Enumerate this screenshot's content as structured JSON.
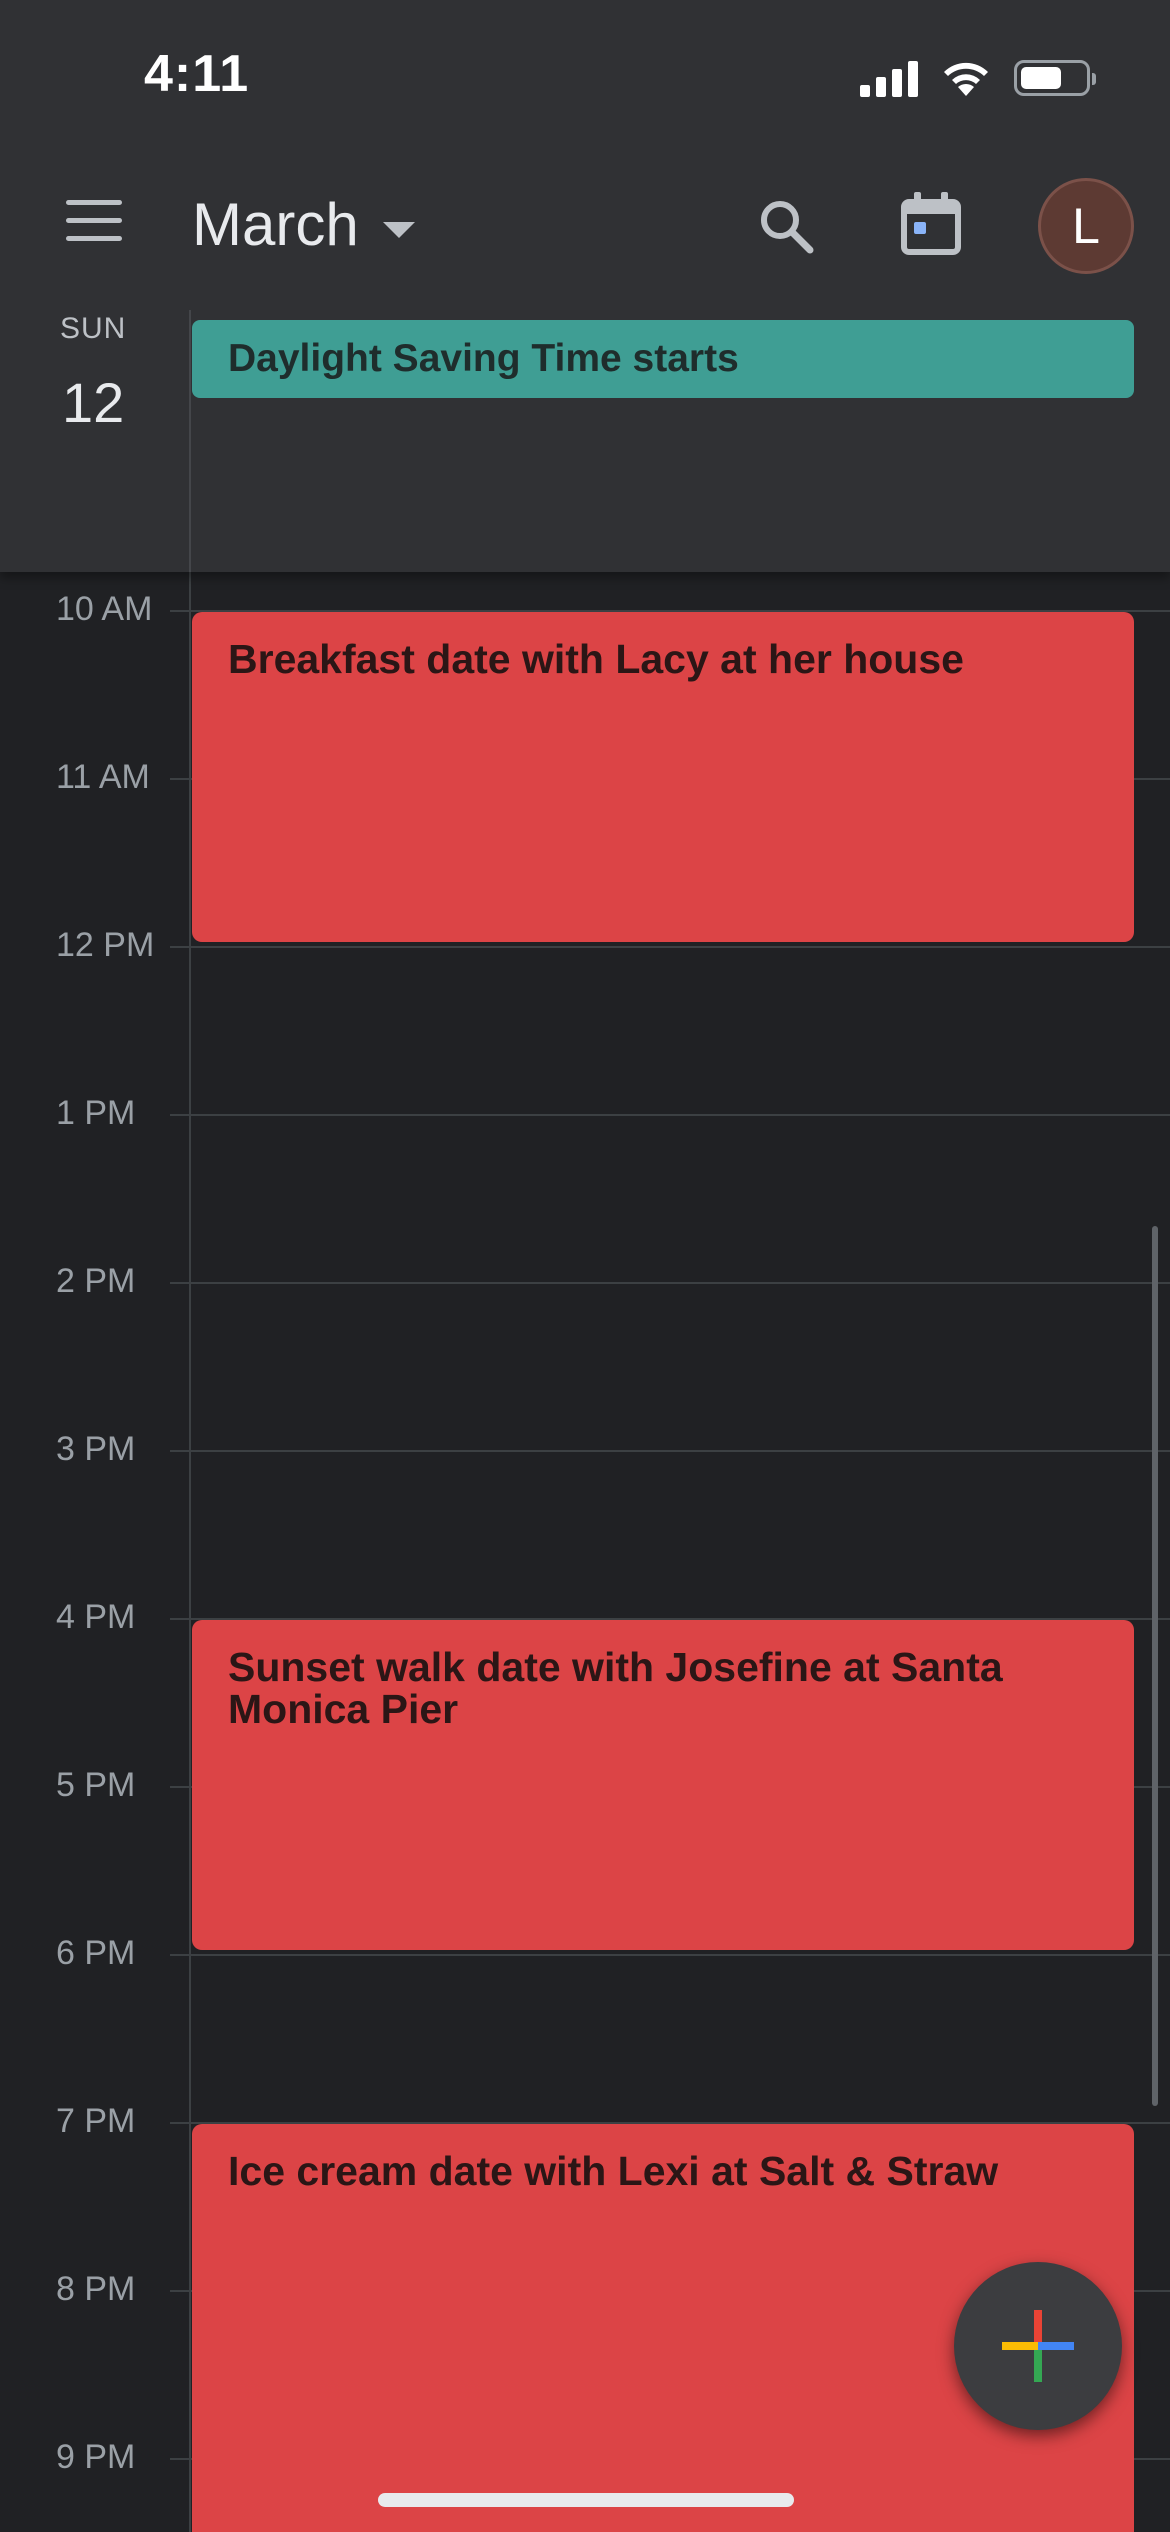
{
  "status_bar": {
    "time": "4:11"
  },
  "header": {
    "month": "March",
    "avatar_initial": "L",
    "day_of_week": "SUN",
    "day_number": "12",
    "all_day_event": "Daylight Saving Time starts"
  },
  "colors": {
    "background": "#202124",
    "header_background": "#303134",
    "all_day_event": "#3f9e94",
    "event": "#dc4446",
    "avatar": "#5d3a33"
  },
  "icons": [
    "menu-icon",
    "dropdown-caret-icon",
    "search-icon",
    "today-calendar-icon",
    "add-icon"
  ],
  "hours": [
    "10 AM",
    "11 AM",
    "12 PM",
    "1 PM",
    "2 PM",
    "3 PM",
    "4 PM",
    "5 PM",
    "6 PM",
    "7 PM",
    "8 PM",
    "9 PM"
  ],
  "events": [
    {
      "title": "Breakfast date with Lacy at her house",
      "start": "10 AM",
      "end": "12 PM"
    },
    {
      "title": "Sunset walk date with Josefine at Santa Monica Pier",
      "start": "4 PM",
      "end": "6 PM"
    },
    {
      "title": "Ice cream date with Lexi at Salt & Straw",
      "start": "7 PM"
    }
  ]
}
